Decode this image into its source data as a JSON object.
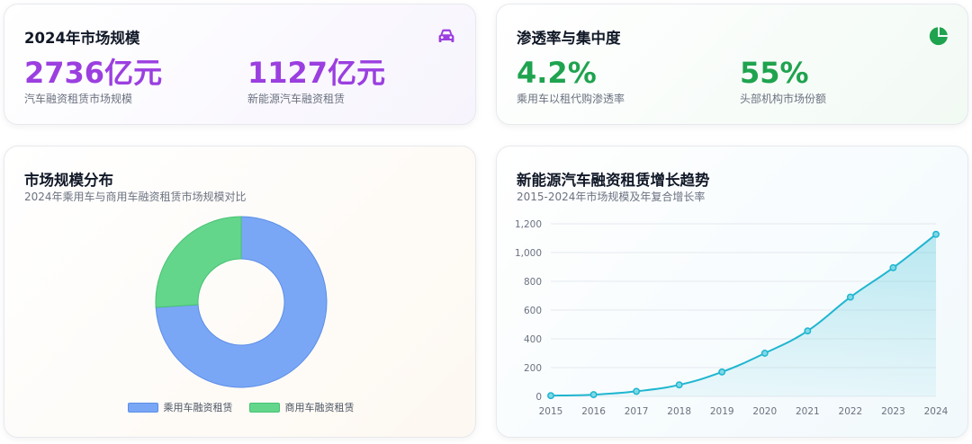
{
  "market_card": {
    "title": "2024年市场规模",
    "icon": "car-icon",
    "stats": [
      {
        "value": "2736亿元",
        "label": "汽车融资租赁市场规模"
      },
      {
        "value": "1127亿元",
        "label": "新能源汽车融资租赁"
      }
    ]
  },
  "penetration_card": {
    "title": "渗透率与集中度",
    "icon": "pie-chart-icon",
    "stats": [
      {
        "value": "4.2%",
        "label": "乘用车以租代购渗透率"
      },
      {
        "value": "55%",
        "label": "头部机构市场份额"
      }
    ]
  },
  "distribution_card": {
    "title": "市场规模分布",
    "subtitle": "2024年乘用车与商用车融资租赁市场规模对比"
  },
  "trend_card": {
    "title": "新能源汽车融资租赁增长趋势",
    "subtitle": "2015-2024年市场规模及年复合增长率"
  },
  "colors": {
    "purple": "#9b3fe0",
    "green": "#1fa34f",
    "passenger": "#7aa7f5",
    "commercial": "#63d68c",
    "trend_line": "#1fb6d0"
  },
  "chart_data": [
    {
      "type": "pie",
      "variant": "donut",
      "categories": [
        "乘用车融资租赁",
        "商用车融资租赁"
      ],
      "values": [
        74,
        26
      ],
      "legend": "bottom"
    },
    {
      "type": "area",
      "x": [
        "2015",
        "2016",
        "2017",
        "2018",
        "2019",
        "2020",
        "2021",
        "2022",
        "2023",
        "2024"
      ],
      "values": [
        5,
        12,
        35,
        80,
        170,
        300,
        455,
        690,
        895,
        1127
      ],
      "ylim": [
        0,
        1200
      ],
      "yticks": [
        "0",
        "200",
        "400",
        "600",
        "800",
        "1,000",
        "1,200"
      ],
      "grid": true
    }
  ]
}
